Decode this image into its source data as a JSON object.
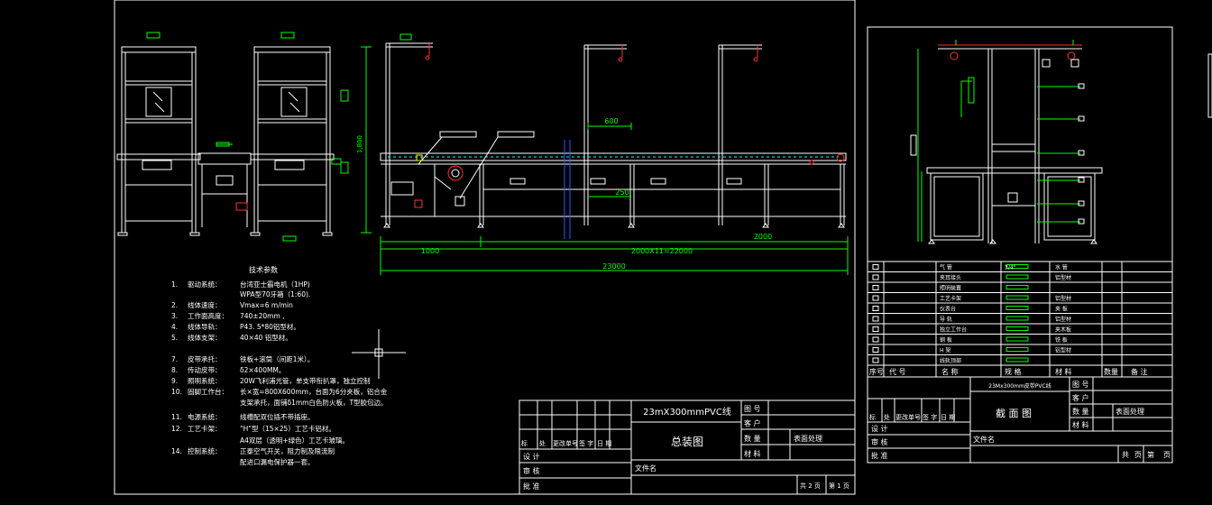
{
  "colors": {
    "background": "#000000",
    "frame": "#ffffff",
    "structure": "#ffffff",
    "dimension": "#00ff00",
    "accent_red": "#ff3030",
    "accent_blue": "#2a5cff",
    "accent_yellow": "#ffff00",
    "accent_cyan": "#00ffff"
  },
  "main_sheet": {
    "dimensions": {
      "height_1800": "1,800",
      "span_600": "600",
      "span_250": "250",
      "left_1000": "1000",
      "middle_span": "2000X11=22000",
      "right_2000": "2000",
      "total_23000": "23000"
    },
    "tech_title": "技术参数",
    "tech_params": [
      {
        "num": "1.",
        "name": "驱动系统：",
        "text": "台湾亚士霸电机（1HP)"
      },
      {
        "num": "",
        "name": "",
        "text": "WPA型70牙箱（1:60)."
      },
      {
        "num": "2.",
        "name": "线体速度：",
        "text": "Vmax=6 m/min"
      },
      {
        "num": "3.",
        "name": "工作面高度：",
        "text": "740±20mm ,"
      },
      {
        "num": "4.",
        "name": "线体导轨：",
        "text": "P43. 5*80铝型材。"
      },
      {
        "num": "5.",
        "name": "线体支架：",
        "text": "40×40 铝型材。"
      },
      {
        "num": "7.",
        "name": "皮带承托：",
        "text": "铁板+滚筒（间距1米）。"
      },
      {
        "num": "8.",
        "name": "传动皮带：",
        "text": "δ2×400MM。"
      },
      {
        "num": "9.",
        "name": "照明系统：",
        "text": "20W飞利浦光管，单支带衔扒罩，独立控制"
      },
      {
        "num": "10.",
        "name": "固脚工作台：",
        "text": "长×宽=800X600mm，台面为6分夹板，铝合金"
      },
      {
        "num": "",
        "name": "",
        "text": "支架承托，面铺δ1mm白色防火板，T型胶包边。"
      },
      {
        "num": "11.",
        "name": "电源系统：",
        "text": "线槽配双位插不带插座。"
      },
      {
        "num": "12.",
        "name": "工艺卡架：",
        "text": "“H”型（15×25）工艺卡铝材。"
      },
      {
        "num": "",
        "name": "",
        "text": "A4双层（透明+绿色）工艺卡玻璃。"
      },
      {
        "num": "14.",
        "name": "控制系统：",
        "text": "正泰空气开关，阻力制及限流制"
      },
      {
        "num": "",
        "name": "",
        "text": "配进口漏电保护器一套。"
      }
    ],
    "title_block": {
      "project": "23mX300mmPVC线",
      "drawing_name": "总装图",
      "labels_right": [
        "图 号",
        "客 户",
        "数 量",
        "材 料"
      ],
      "surface_label": "表面处理",
      "file_label": "文件名",
      "rev_header": [
        "标",
        "处",
        "更改单号",
        "签 字",
        "日 期"
      ],
      "sign_rows": [
        "设 计",
        "审 核",
        "批 准"
      ],
      "total_pages": "共 2 页",
      "page_no": "第 1 页"
    }
  },
  "section_sheet": {
    "bom_rows": [
      {
        "item": "气 管",
        "spec": "3/4\"",
        "material": "水 管"
      },
      {
        "item": "夹耳接头",
        "spec": "",
        "material": "铝型材"
      },
      {
        "item": "照明装置",
        "spec": "",
        "material": ""
      },
      {
        "item": "工艺卡架",
        "spec": "",
        "material": "铝型材"
      },
      {
        "item": "仪表台",
        "spec": "",
        "material": "夹 板"
      },
      {
        "item": "导 轨",
        "spec": "",
        "material": "铝型材"
      },
      {
        "item": "独立工作台",
        "spec": "",
        "material": "夹木板"
      },
      {
        "item": "钢 板",
        "spec": "",
        "material": "铁 板"
      },
      {
        "item": "H 架",
        "spec": "",
        "material": "铝型材"
      },
      {
        "item": "线轨顶部",
        "spec": "",
        "material": ""
      }
    ],
    "bom_header": [
      "序号",
      "代 号",
      "名 称",
      "规 格",
      "材 料",
      "数量",
      "备 注"
    ],
    "title_block": {
      "project": "23Mx300mm皮带PVC线",
      "drawing_name": "截 面 图",
      "labels_right": [
        "图 号",
        "客 户",
        "数 量",
        "材 料"
      ],
      "surface_label": "表面处理",
      "file_label": "文件名",
      "rev_header": [
        "标",
        "处",
        "更改单号",
        "签 字",
        "日 期"
      ],
      "sign_rows": [
        "设 计",
        "审 核",
        "批 准"
      ],
      "total_pages": "共",
      "page_unit": "页",
      "page_no": "第",
      "page_no_unit": "页"
    }
  }
}
